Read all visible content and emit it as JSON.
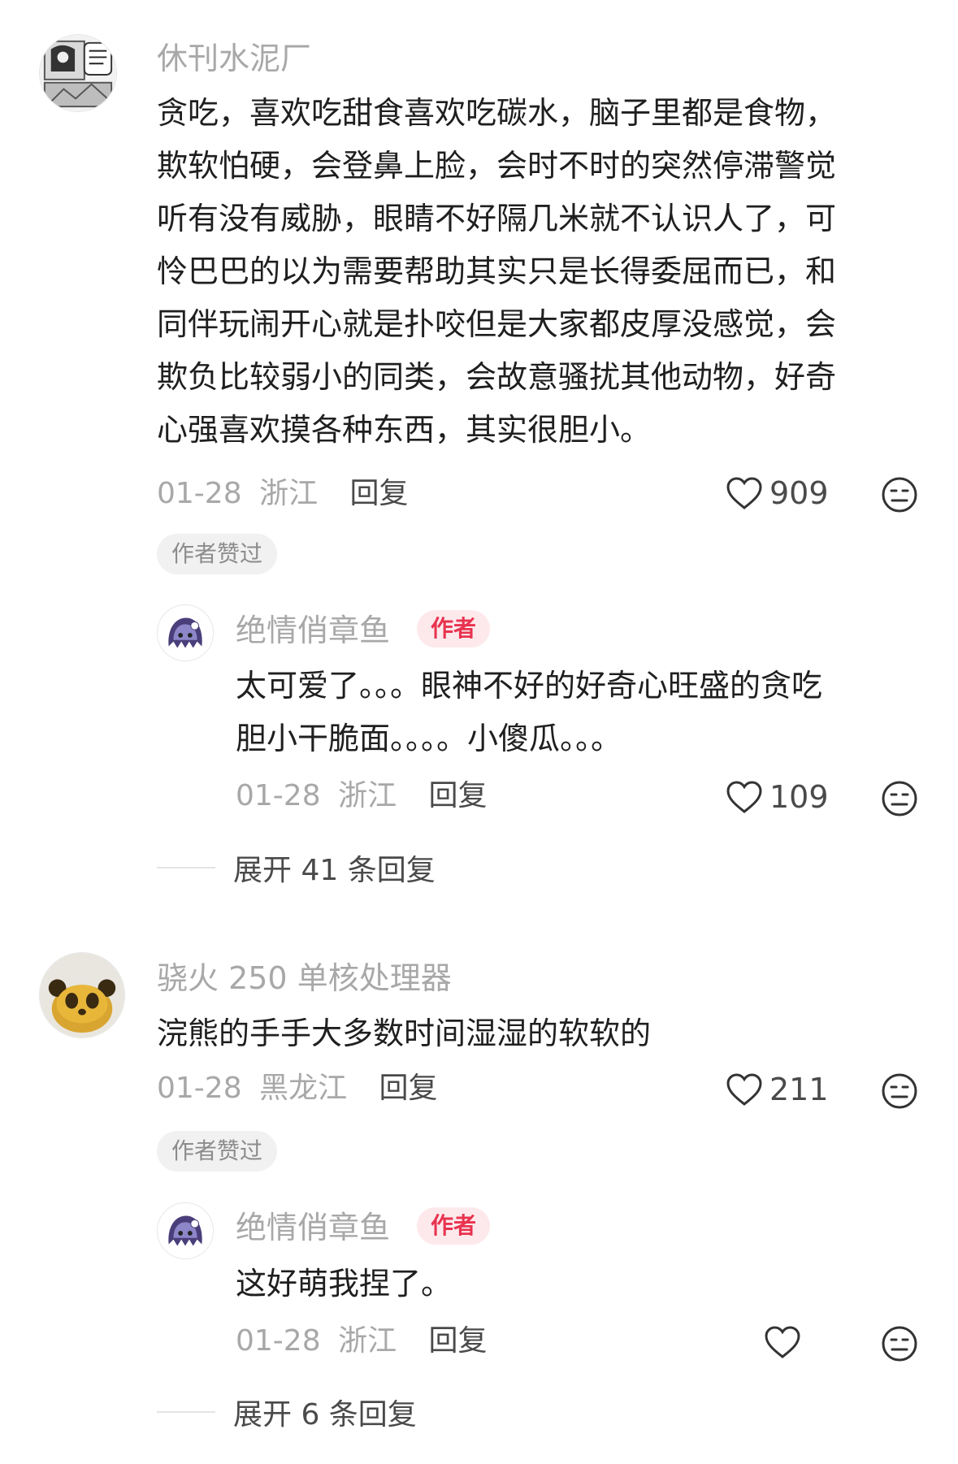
{
  "comments": [
    {
      "username": "休刊水泥厂",
      "lines": [
        "贪吃，喜欢吃甜食喜欢吃碳水，脑子里都是食物，",
        "欺软怕硬，会登鼻上脸，会时不时的突然停滞警觉",
        "听有没有威胁，眼睛不好隔几米就不认识人了，可",
        "怜巴巴的以为需要帮助其实只是长得委屈而已，和",
        "同伴玩闹开心就是扑咬但是大家都皮厚没感觉，会",
        "欺负比较弱小的同类，会故意骚扰其他动物，好奇",
        "心强喜欢摸各种东西，其实很胆小。"
      ],
      "date": "01-28",
      "location": "浙江",
      "reply_label": "回复",
      "likes": "909",
      "badge": "作者赞过",
      "avatar_icon": "manga-panel-avatar",
      "reply": {
        "username": "绝情俏章鱼",
        "author_tag": "作者",
        "lines": [
          "太可爱了。。。眼神不好的好奇心旺盛的贪吃",
          "胆小干脆面。。。。小傻瓜。。。"
        ],
        "date": "01-28",
        "location": "浙江",
        "reply_label": "回复",
        "likes": "109",
        "avatar_icon": "octopus-avatar"
      },
      "expand_label": "展开 41 条回复"
    },
    {
      "username": "骁火 250 单核处理器",
      "lines": [
        "浣熊的手手大多数时间湿湿的软软的"
      ],
      "date": "01-28",
      "location": "黑龙江",
      "reply_label": "回复",
      "likes": "211",
      "badge": "作者赞过",
      "avatar_icon": "panda-avatar",
      "reply": {
        "username": "绝情俏章鱼",
        "author_tag": "作者",
        "lines": [
          "这好萌我捏了。"
        ],
        "date": "01-28",
        "location": "浙江",
        "reply_label": "回复",
        "likes": "",
        "avatar_icon": "octopus-avatar"
      },
      "expand_label": "展开 6 条回复"
    }
  ],
  "icons": {
    "like": "heart-outline-icon",
    "dislike": "meh-face-icon"
  },
  "colors": {
    "author_tag_bg": "#fde9ec",
    "author_tag_text": "#e8334f",
    "muted": "#a8a8a8"
  }
}
